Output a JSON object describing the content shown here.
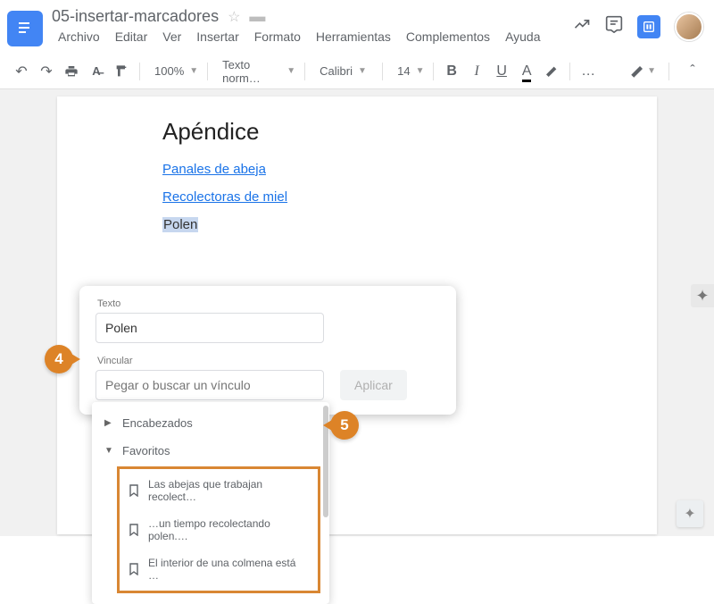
{
  "header": {
    "doc_title": "05-insertar-marcadores",
    "menus": [
      "Archivo",
      "Editar",
      "Ver",
      "Insertar",
      "Formato",
      "Herramientas",
      "Complementos",
      "Ayuda"
    ]
  },
  "toolbar": {
    "zoom": "100%",
    "style": "Texto norm…",
    "font": "Calibri",
    "size": "14",
    "bold": "B",
    "italic": "I",
    "underline": "U",
    "textcolor": "A",
    "more": "…"
  },
  "document": {
    "heading": "Apéndice",
    "links": [
      "Panales de abeja",
      "Recolectoras de miel"
    ],
    "selected_text": "Polen"
  },
  "link_dialog": {
    "text_label": "Texto",
    "text_value": "Polen",
    "link_label": "Vincular",
    "link_placeholder": "Pegar o buscar un vínculo",
    "apply_label": "Aplicar",
    "sections": {
      "headings": "Encabezados",
      "bookmarks": "Favoritos"
    },
    "bookmark_items": [
      "Las abejas que trabajan recolect…",
      "…un tiempo recolectando polen.…",
      "El interior de una colmena está …"
    ]
  },
  "callouts": {
    "c4": "4",
    "c5": "5"
  }
}
